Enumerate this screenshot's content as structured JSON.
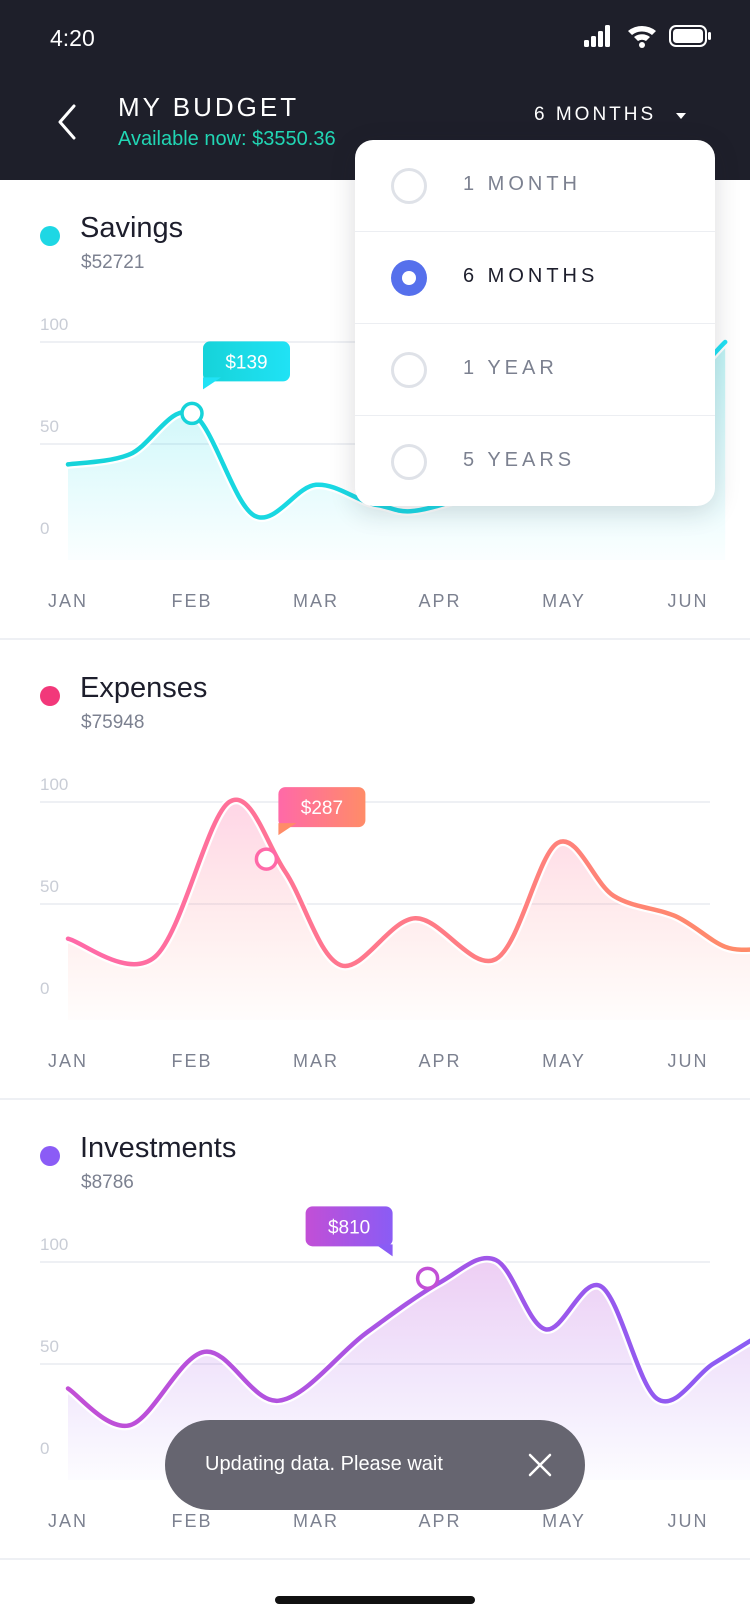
{
  "status_bar": {
    "time": "4:20"
  },
  "header": {
    "title": "MY BUDGET",
    "available": "Available now: $3550.36",
    "period_label": "6 MONTHS"
  },
  "period_menu": {
    "options": [
      {
        "label": "1 MONTH",
        "selected": false
      },
      {
        "label": "6 MONTHS",
        "selected": true
      },
      {
        "label": "1 YEAR",
        "selected": false
      },
      {
        "label": "5 YEARS",
        "selected": false
      }
    ]
  },
  "cards": [
    {
      "name": "Savings",
      "amount": "$52721",
      "color": "#1ed7e4",
      "tooltip": "$139"
    },
    {
      "name": "Expenses",
      "amount": "$75948",
      "color": "#f2387a",
      "tooltip": "$287"
    },
    {
      "name": "Investments",
      "amount": "$8786",
      "color": "#8b5cf6",
      "tooltip": "$810"
    }
  ],
  "chart_data": [
    {
      "type": "area",
      "title": "Savings",
      "categories": [
        "JAN",
        "FEB",
        "MAR",
        "APR",
        "MAY",
        "JUN"
      ],
      "yticks": [
        0,
        50,
        100
      ],
      "ylim": [
        0,
        100
      ],
      "x": [
        0,
        0.5,
        1,
        1.5,
        2,
        2.5,
        3,
        4.5,
        5.3
      ],
      "values": [
        40,
        45,
        65,
        15,
        30,
        20,
        20,
        55,
        100
      ],
      "colors": [
        "#16d3d9",
        "#20e2f5"
      ],
      "highlight": {
        "x": 1,
        "y": 65,
        "label": "$139"
      }
    },
    {
      "type": "area",
      "title": "Expenses",
      "categories": [
        "JAN",
        "FEB",
        "MAR",
        "APR",
        "MAY",
        "JUN"
      ],
      "yticks": [
        0,
        50,
        100
      ],
      "ylim": [
        0,
        100
      ],
      "x": [
        0,
        0.7,
        1.3,
        1.75,
        2.2,
        2.8,
        3.45,
        3.95,
        4.4,
        4.9,
        5.3,
        5.6
      ],
      "values": [
        33,
        24,
        100,
        66,
        20,
        43,
        23,
        80,
        54,
        44,
        29,
        28
      ],
      "colors": [
        "#ff69a8",
        "#ff8c68"
      ],
      "highlight": {
        "x": 1.6,
        "y": 72,
        "label": "$287"
      }
    },
    {
      "type": "area",
      "title": "Investments",
      "categories": [
        "JAN",
        "FEB",
        "MAR",
        "APR",
        "MAY",
        "JUN"
      ],
      "yticks": [
        0,
        50,
        100
      ],
      "ylim": [
        0,
        100
      ],
      "x": [
        0,
        0.5,
        1.1,
        1.7,
        2.4,
        3.0,
        3.45,
        3.85,
        4.3,
        4.75,
        5.2,
        5.6
      ],
      "values": [
        38,
        20,
        56,
        32,
        65,
        90,
        101,
        67,
        88,
        33,
        50,
        65
      ],
      "colors": [
        "#c24fd6",
        "#8a5cf5"
      ],
      "highlight": {
        "x": 2.9,
        "y": 92,
        "label": "$810"
      }
    }
  ],
  "toast": {
    "message": "Updating data. Please wait"
  }
}
